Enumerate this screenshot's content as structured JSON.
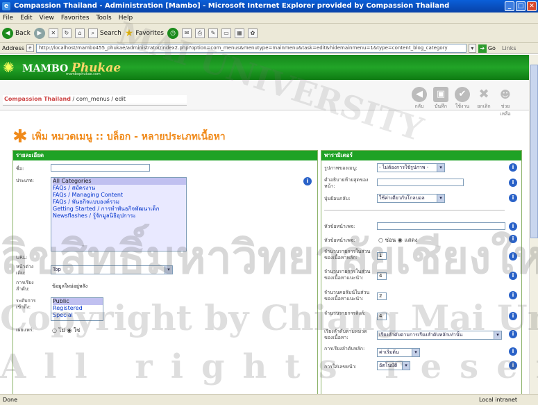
{
  "window": {
    "title": "Compassion Thailand - Administration [Mambo] - Microsoft Internet Explorer provided by Compassion Thailand",
    "minimize": "_",
    "maximize": "□",
    "close": "✕"
  },
  "menu": [
    "File",
    "Edit",
    "View",
    "Favorites",
    "Tools",
    "Help"
  ],
  "toolbar": {
    "back": "Back",
    "search": "Search",
    "favorites": "Favorites"
  },
  "address": {
    "label": "Address",
    "url": "http://localhost/mambo455_phukae/administrator/index2.php?option=com_menus&menutype=mainmenu&task=edit&hidemainmenu=1&type=content_blog_category",
    "go": "Go",
    "links": "Links"
  },
  "mambo": {
    "logo": "MAMBO",
    "logo2": "Phukae",
    "sub": "mambophukae.com"
  },
  "breadcrumb": {
    "site": "Compassion Thailand",
    "path": " / com_menus / edit"
  },
  "admin_tools": [
    "กลับ",
    "บันทึก",
    "ใช้งาน",
    "ยกเลิก",
    "ช่วยเหลือ"
  ],
  "heading": "เพิ่ม หมวดเมนู :: บล็อก - หลายประเภทเนื้อหา",
  "left": {
    "header": "รายละเอียด",
    "name_label": "ชื่อ:",
    "category_label": "ประเภท:",
    "categories": [
      "All Categories",
      "FAQs / สมัครงาน",
      "FAQs / Managing Content",
      "FAQs / พันธกิจแบบองค์รวม",
      "Getting Started / การทำพันธกิจพัฒนาเด็ก",
      "Newsflashes / รู้จักมูลนิธิอุปการะ"
    ],
    "url_label": "URL:",
    "parent_label": "หน้าต่าง เดิม:",
    "parent_value": "Top",
    "order_label": "การเรียง ลำดับ:",
    "order_value": "ข้อมูลใหม่อยู่หลัง",
    "access_label": "ระดับการ เข้าถึง:",
    "access": [
      "Public",
      "Registered",
      "Special"
    ],
    "publish_label": "เผยแพร่:",
    "no": "ไม่",
    "yes": "ใช่"
  },
  "right": {
    "header": "พารามิเตอร์",
    "rows": [
      {
        "label": "รูปภาพของเมนู:",
        "value": "- ไม่ต้องการใช้รูปภาพ -",
        "kind": "select"
      },
      {
        "label": "คำอธิบายท้ายสุดของหน้า:",
        "value": "",
        "kind": "input"
      },
      {
        "label": "ปุ่มย้อนกลับ:",
        "value": "ใช้ค่าเดียวกับโกลบอล",
        "kind": "select"
      },
      {
        "label": "หัวข้อหน้าเพจ:",
        "value": "",
        "kind": "input"
      },
      {
        "label": "หัวข้อหน้าเพจ:",
        "value": "",
        "kind": "radio",
        "opt1": "ซ่อน",
        "opt2": "แสดง"
      },
      {
        "label": "จำนวนรายการในส่วนของเนื้อหาหลัก:",
        "value": "1",
        "kind": "small"
      },
      {
        "label": "จำนวนรายการในส่วนของเนื้อหาแนะนำ:",
        "value": "4",
        "kind": "small"
      },
      {
        "label": "จำนวนคอลัมน์ในส่วนของเนื้อหาแนะนำ:",
        "value": "2",
        "kind": "small"
      },
      {
        "label": "จำนวนรายการลิงก์:",
        "value": "4",
        "kind": "small"
      },
      {
        "label": "เรียงลำดับตามหมวดของเนื้อหา:",
        "value": "เรียงลำดับตามการเรียงลำดับหลักเท่านั้น",
        "kind": "select"
      },
      {
        "label": "การเรียงลำดับหลัก:",
        "value": "ค่าเริ่มต้น",
        "kind": "select"
      },
      {
        "label": "การใส่เลขหน้า:",
        "value": "อัตโนมัติ",
        "kind": "select"
      }
    ]
  },
  "status": {
    "left": "Done",
    "zone": "Local intranet"
  },
  "watermark": {
    "line1": "MAI UNIVERSITY",
    "line2": "ลิขสิทธิ์มหาวิทยาลัยเชียงใหม่",
    "line3": "Copyright by Chiang Mai University",
    "line4": "All rights reserved"
  }
}
